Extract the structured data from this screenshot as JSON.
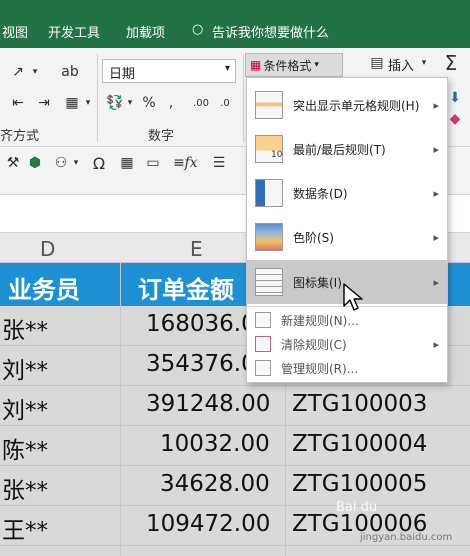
{
  "ribbon_tabs": [
    "视图",
    "开发工具",
    "加载项",
    "告诉我你想要做什么"
  ],
  "ribbon": {
    "font_group_label": "齐方式",
    "number_format": "日期",
    "number_group_label": "数字",
    "percent": "%",
    "comma": ",",
    "conditional_format_label": "条件格式",
    "insert_label": "插入",
    "sum_symbol": "Σ",
    "omega": "Ω",
    "fx": "fx"
  },
  "conditional_menu": {
    "items": [
      {
        "label": "突出显示单元格规则(H)",
        "icon": "highlight-cells-icon"
      },
      {
        "label": "最前/最后规则(T)",
        "icon": "top-bottom-icon",
        "badge": "10"
      },
      {
        "label": "数据条(D)",
        "icon": "data-bars-icon"
      },
      {
        "label": "色阶(S)",
        "icon": "color-scales-icon"
      },
      {
        "label": "图标集(I)",
        "icon": "icon-sets-icon"
      }
    ],
    "small_items": [
      {
        "label": "新建规则(N)..."
      },
      {
        "label": "清除规则(C)"
      },
      {
        "label": "管理规则(R)..."
      }
    ]
  },
  "grid": {
    "columns": [
      "D",
      "E"
    ],
    "headers": [
      "业务员",
      "订单金额"
    ],
    "rows": [
      {
        "name": "张**",
        "amount": "168036.0",
        "order": ""
      },
      {
        "name": "刘**",
        "amount": "354376.0",
        "order": ""
      },
      {
        "name": "刘**",
        "amount": "391248.00",
        "order": "ZTG100003"
      },
      {
        "name": "陈**",
        "amount": "10032.00",
        "order": "ZTG100004"
      },
      {
        "name": "张**",
        "amount": "34628.00",
        "order": "ZTG100005"
      },
      {
        "name": "王**",
        "amount": "109472.00",
        "order": "ZTG100006"
      }
    ]
  },
  "watermark": "Bai du",
  "watermark_url": "jingyan.baidu.com",
  "colors": {
    "accent": "#217346",
    "header_blue": "#1e90d6"
  }
}
